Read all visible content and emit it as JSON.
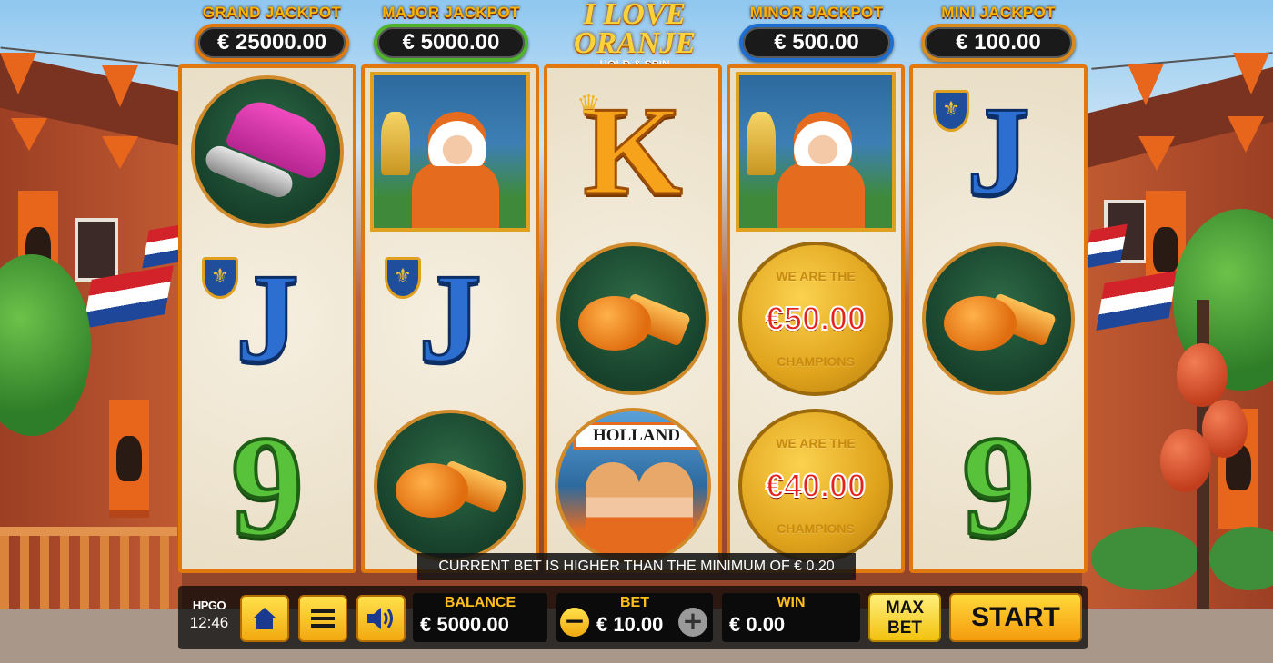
{
  "jackpots": [
    {
      "title": "GRAND JACKPOT",
      "value": "€ 25000.00"
    },
    {
      "title": "MAJOR JACKPOT",
      "value": "€ 5000.00"
    },
    {
      "title": "MINOR JACKPOT",
      "value": "€ 500.00"
    },
    {
      "title": "MINI JACKPOT",
      "value": "€ 100.00"
    }
  ],
  "logo": {
    "main_line1": "I LOVE",
    "main_line2": "ORANJE",
    "sub": "HOLD & SPIN"
  },
  "reels": [
    [
      "football-boot",
      "J",
      "9"
    ],
    [
      "fan-with-trophy",
      "J",
      "whistle"
    ],
    [
      "K",
      "whistle",
      "holland-fans"
    ],
    [
      "fan-with-trophy",
      "coin",
      "coin"
    ],
    [
      "J",
      "whistle",
      "9"
    ]
  ],
  "symbols": {
    "J": "J",
    "K": "K",
    "nine": "9",
    "holland_sign": "HOLLAND",
    "coin_top": "WE ARE THE",
    "coin_bottom": "CHAMPIONS",
    "coin_1": "€50.00",
    "coin_2": "€40.00"
  },
  "message": "CURRENT BET IS HIGHER THAN THE MINIMUM OF € 0.20",
  "controls": {
    "brand": "HPGO",
    "time": "12:46",
    "balance_label": "BALANCE",
    "balance_value": "€ 5000.00",
    "bet_label": "BET",
    "bet_value": "€ 10.00",
    "bet_decrease": "−",
    "bet_increase": "+",
    "win_label": "WIN",
    "win_value": "€ 0.00",
    "maxbet_label": "MAX BET",
    "start_label": "START"
  },
  "icons": [
    "home-icon",
    "menu-icon",
    "speaker-icon"
  ],
  "colors": {
    "accent": "#e0780e",
    "button": "#f2a90f",
    "panel_label": "#ffbf1e",
    "coin_value": "#e4241c"
  }
}
